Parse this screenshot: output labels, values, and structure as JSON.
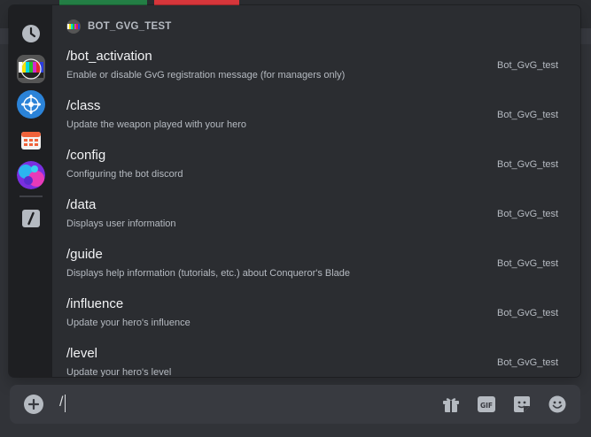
{
  "popup": {
    "section_title": "BOT_GVG_TEST",
    "rail": [
      {
        "name": "recent-icon"
      },
      {
        "name": "test-pattern-app-icon"
      },
      {
        "name": "network-app-icon"
      },
      {
        "name": "calendar-app-icon"
      },
      {
        "name": "colorful-app-icon"
      },
      {
        "name": "slash-commands-icon"
      }
    ],
    "commands": [
      {
        "name": "/bot_activation",
        "description": "Enable or disable GvG registration message (for managers only)",
        "source": "Bot_GvG_test"
      },
      {
        "name": "/class",
        "description": "Update the weapon played with your hero",
        "source": "Bot_GvG_test"
      },
      {
        "name": "/config",
        "description": "Configuring the bot discord",
        "source": "Bot_GvG_test"
      },
      {
        "name": "/data",
        "description": "Displays user information",
        "source": "Bot_GvG_test"
      },
      {
        "name": "/guide",
        "description": "Displays help information (tutorials, etc.) about Conqueror's Blade",
        "source": "Bot_GvG_test"
      },
      {
        "name": "/influence",
        "description": "Update your hero's influence",
        "source": "Bot_GvG_test"
      },
      {
        "name": "/level",
        "description": "Update your hero's level",
        "source": "Bot_GvG_test"
      }
    ]
  },
  "chatbar": {
    "input_value": "/",
    "icons": [
      "add-icon",
      "gift-icon",
      "gif-icon",
      "sticker-icon",
      "emoji-icon"
    ],
    "gif_label": "GIF"
  },
  "colors": {
    "background": "#313338",
    "popup": "#2b2d31",
    "rail": "#1e1f22",
    "text_primary": "#f2f3f5",
    "text_secondary": "#b5bac1"
  }
}
